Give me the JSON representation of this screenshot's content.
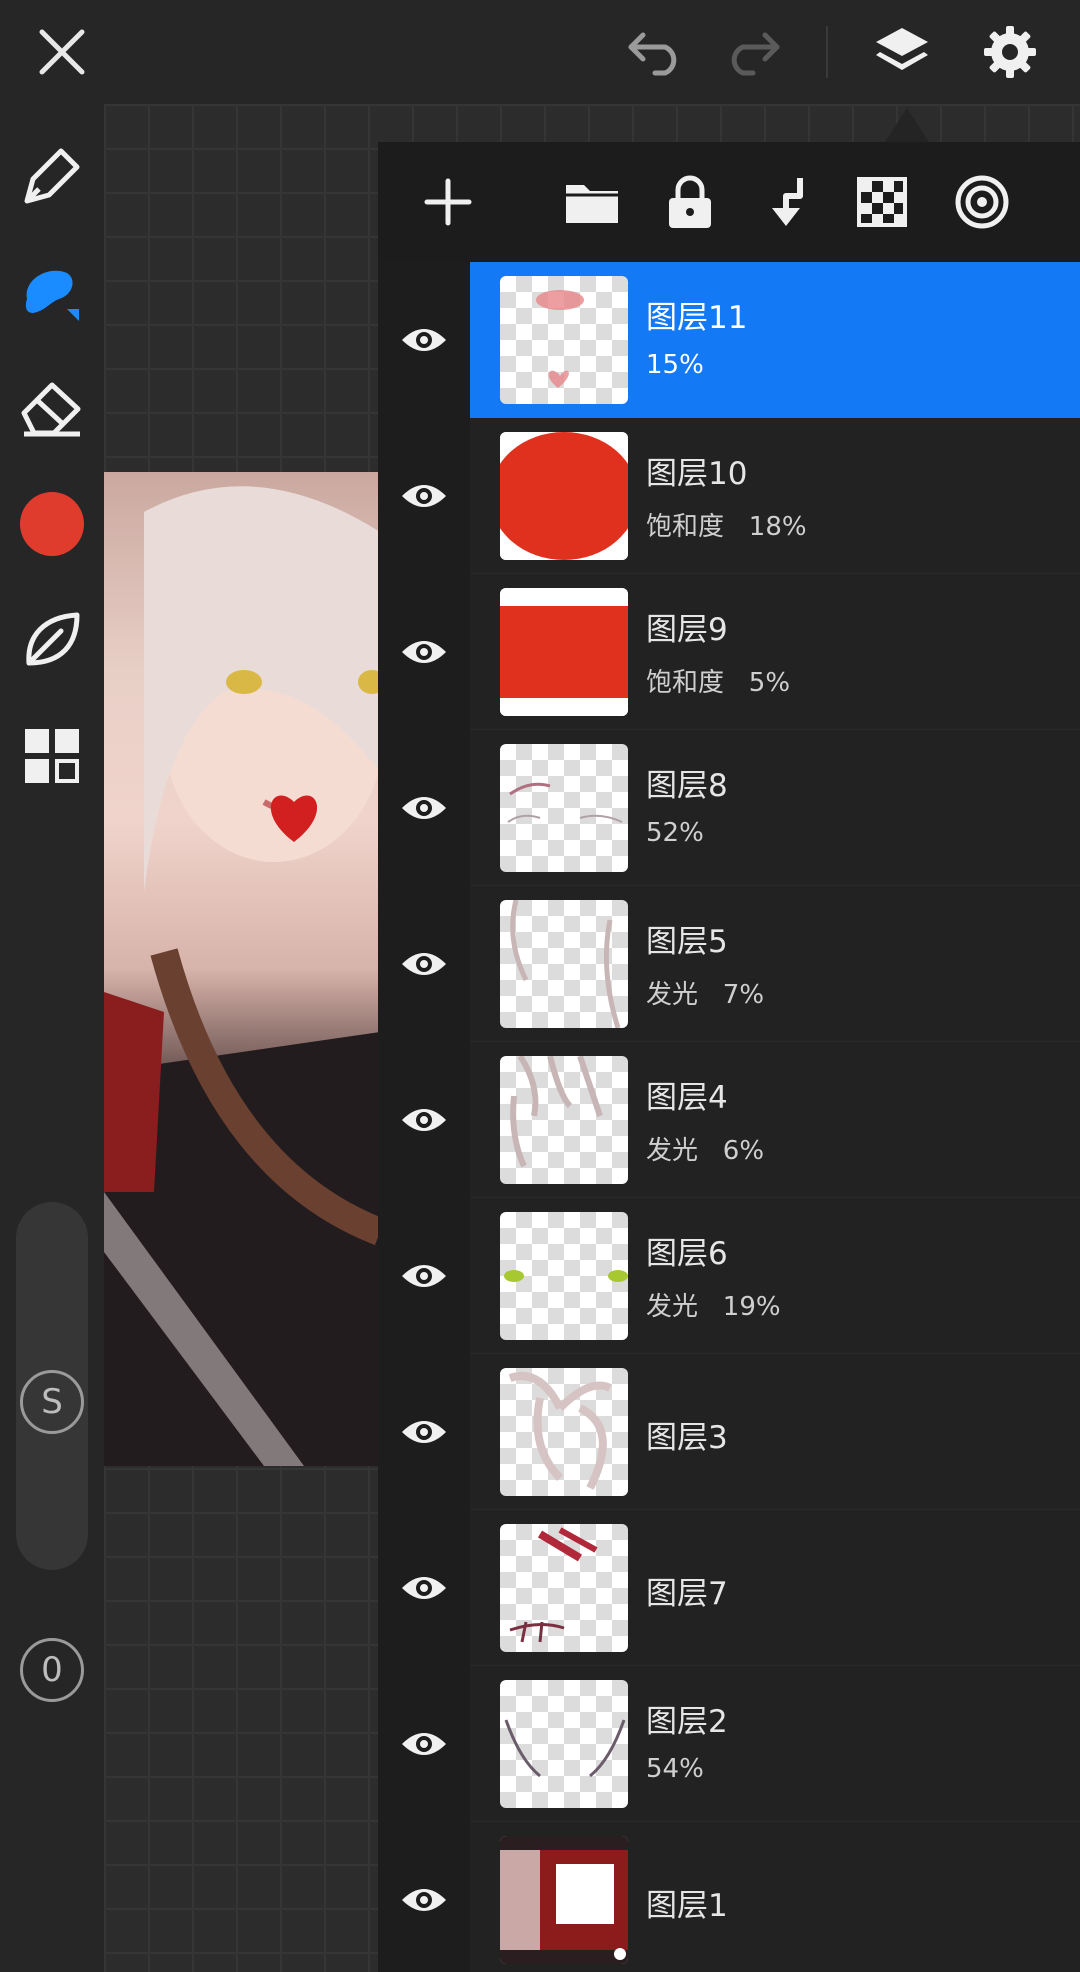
{
  "topbar": {
    "icons": [
      "close-icon",
      "undo-icon",
      "redo-icon",
      "layers-icon",
      "settings-icon"
    ]
  },
  "left_toolbar": {
    "tools": [
      "pen-icon",
      "smudge-brush-icon",
      "eraser-icon",
      "color-swatch",
      "leaf-icon",
      "grid-icon"
    ],
    "current_color": "#e03c2e",
    "slider_label": "S",
    "opacity_label": "0"
  },
  "layers_toolbar": {
    "icons": [
      "add-layer-icon",
      "folder-icon",
      "lock-icon",
      "merge-down-icon",
      "transparency-icon",
      "target-icon"
    ]
  },
  "layers": [
    {
      "name": "图层11",
      "sub": "15%",
      "selected": true
    },
    {
      "name": "图层10",
      "sub": "饱和度   18%",
      "selected": false
    },
    {
      "name": "图层9",
      "sub": "饱和度   5%",
      "selected": false
    },
    {
      "name": "图层8",
      "sub": "52%",
      "selected": false
    },
    {
      "name": "图层5",
      "sub": "发光   7%",
      "selected": false
    },
    {
      "name": "图层4",
      "sub": "发光   6%",
      "selected": false
    },
    {
      "name": "图层6",
      "sub": "发光   19%",
      "selected": false
    },
    {
      "name": "图层3",
      "sub": "",
      "selected": false
    },
    {
      "name": "图层7",
      "sub": "",
      "selected": false
    },
    {
      "name": "图层2",
      "sub": "54%",
      "selected": false
    },
    {
      "name": "图层1",
      "sub": "",
      "selected": false
    }
  ],
  "colors": {
    "accent": "#1479f5",
    "background": "#262626",
    "brush_active": "#1a8cff"
  }
}
